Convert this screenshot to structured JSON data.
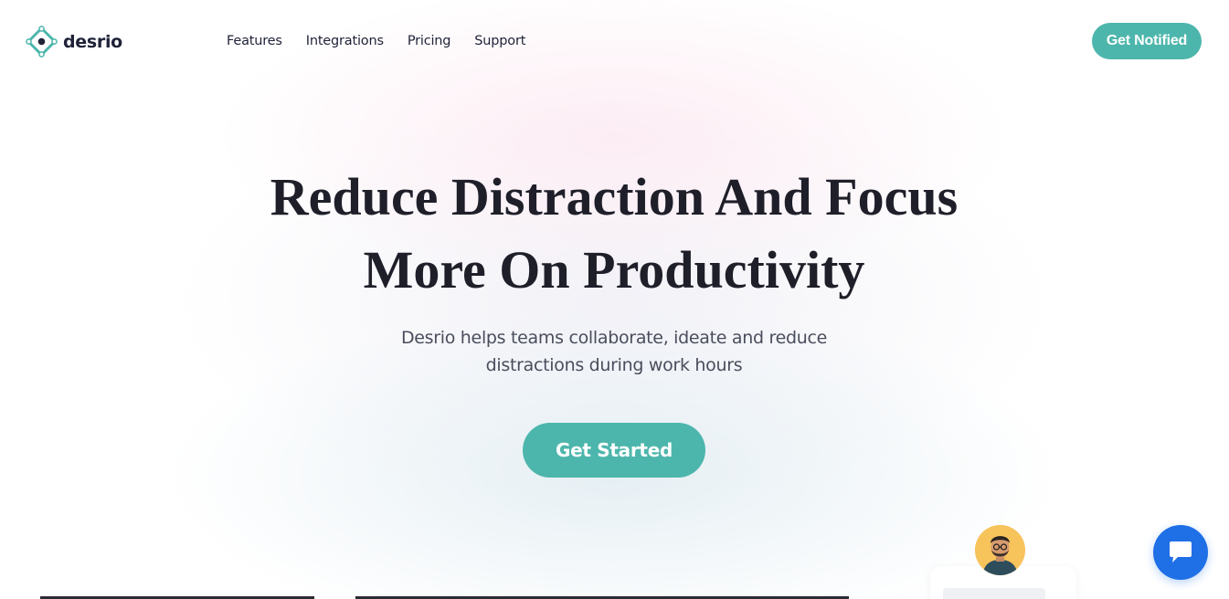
{
  "brand": {
    "name": "desrio",
    "logo_icon": "diamond-dot-icon",
    "accent_color": "#4db6ac"
  },
  "nav": {
    "items": [
      {
        "label": "Features"
      },
      {
        "label": "Integrations"
      },
      {
        "label": "Pricing"
      },
      {
        "label": "Support"
      }
    ],
    "cta_label": "Get Notified"
  },
  "hero": {
    "title_line1": "Reduce Distraction And Focus",
    "title_line2": "More On Productivity",
    "subtitle_line1": "Desrio helps teams collaborate, ideate and reduce",
    "subtitle_line2": "distractions during work hours",
    "cta_label": "Get Started"
  },
  "widgets": {
    "avatar_icon": "user-avatar",
    "chat_icon": "chat-bubble-icon",
    "chat_color": "#1f6fe6"
  }
}
